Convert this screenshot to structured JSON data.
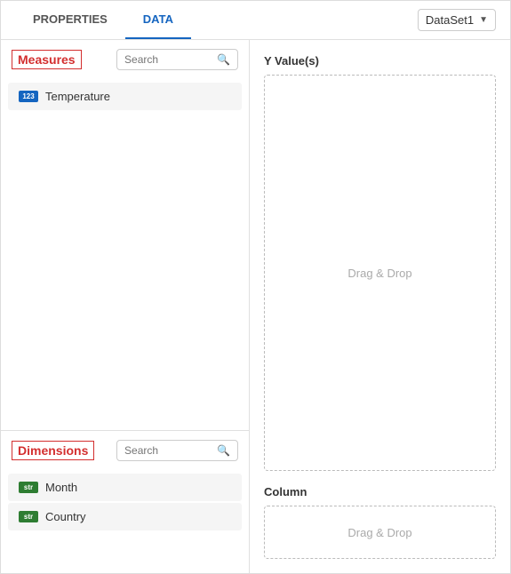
{
  "header": {
    "tab_properties": "PROPERTIES",
    "tab_data": "DATA",
    "dataset_label": "DataSet1"
  },
  "left_panel": {
    "measures": {
      "label": "Measures",
      "search_placeholder": "Search",
      "items": [
        {
          "type": "123",
          "name": "Temperature"
        }
      ]
    },
    "dimensions": {
      "label": "Dimensions",
      "search_placeholder": "Search",
      "items": [
        {
          "type": "str",
          "name": "Month"
        },
        {
          "type": "str",
          "name": "Country"
        }
      ]
    }
  },
  "right_panel": {
    "y_values_label": "Y Value(s)",
    "y_values_drop": "Drag & Drop",
    "column_label": "Column",
    "column_drop": "Drag & Drop"
  },
  "icons": {
    "search": "🔍",
    "chevron_down": "▼"
  }
}
